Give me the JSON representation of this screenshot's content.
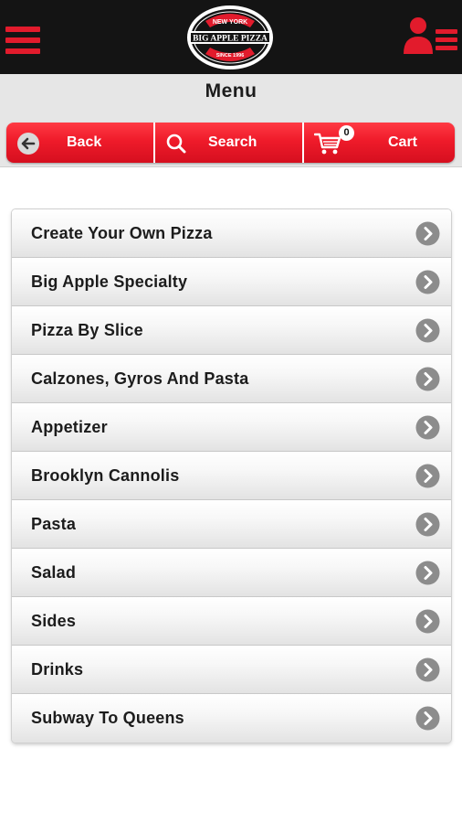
{
  "header": {
    "logo": {
      "top_text": "NEW YORK",
      "main_text": "BIG APPLE PIZZA",
      "bottom_text": "SINCE 1996"
    },
    "menu_icon": "hamburger-icon",
    "user_icon": "user-list-icon"
  },
  "page": {
    "title": "Menu"
  },
  "actions": {
    "back_label": "Back",
    "search_label": "Search",
    "cart_label": "Cart",
    "cart_count": "0"
  },
  "menu": {
    "items": [
      {
        "label": "Create Your Own Pizza"
      },
      {
        "label": "Big Apple Specialty"
      },
      {
        "label": "Pizza By Slice"
      },
      {
        "label": "Calzones, Gyros And Pasta"
      },
      {
        "label": "Appetizer"
      },
      {
        "label": "Brooklyn Cannolis"
      },
      {
        "label": "Pasta"
      },
      {
        "label": "Salad"
      },
      {
        "label": "Sides"
      },
      {
        "label": "Drinks"
      },
      {
        "label": "Subway To Queens"
      }
    ]
  },
  "colors": {
    "brand_red": "#e21b2c",
    "header_bg": "#141414",
    "title_bg": "#e6e6e6",
    "chevron_gray": "#8c8c8c"
  }
}
